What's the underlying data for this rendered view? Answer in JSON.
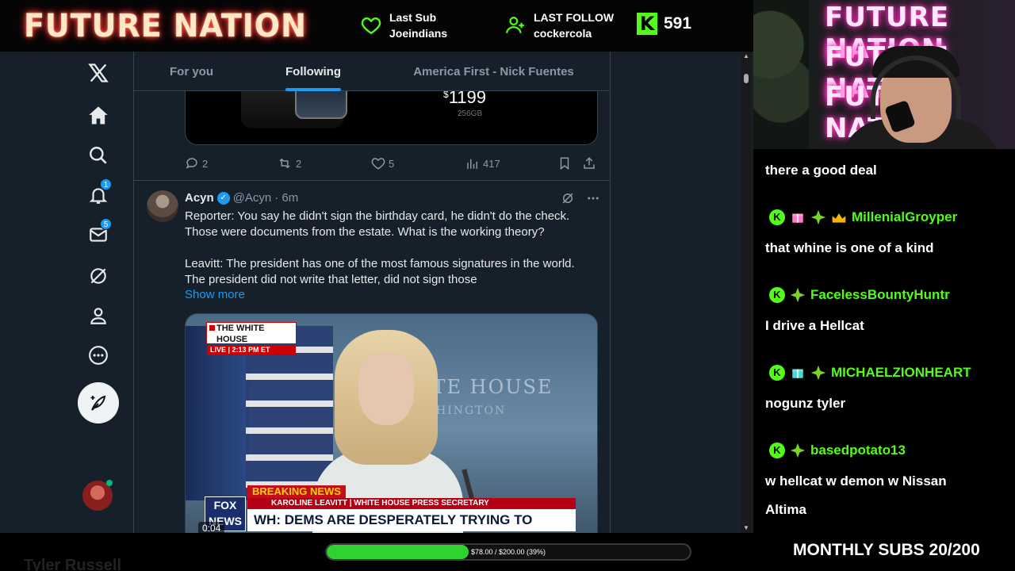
{
  "overlay": {
    "logo": "FUTURE NATION",
    "last_sub": {
      "title": "Last Sub",
      "name": "Joeindians"
    },
    "last_follow": {
      "title": "LAST FOLLOW",
      "name": "cockercola"
    },
    "kick_icon": "K",
    "viewer_count": "591",
    "accent_color": "#53fc18"
  },
  "xnav": {
    "items": [
      {
        "icon": "x-logo-icon"
      },
      {
        "icon": "home-icon"
      },
      {
        "icon": "search-icon"
      },
      {
        "icon": "bell-icon",
        "badge": "1"
      },
      {
        "icon": "mail-icon",
        "badge": "5"
      },
      {
        "icon": "grok-icon"
      },
      {
        "icon": "profile-icon"
      },
      {
        "icon": "more-icon"
      }
    ],
    "compose_icon": "feather-icon"
  },
  "tabs": [
    {
      "label": "For you",
      "active": false
    },
    {
      "label": "Following",
      "active": true
    },
    {
      "label": "America First - Nick Fuentes",
      "active": false
    }
  ],
  "prev_tweet": {
    "price_symbol": "$",
    "price": "1199",
    "storage": "256GB",
    "replies": "2",
    "retweets": "2",
    "likes": "5",
    "views": "417"
  },
  "tweet": {
    "name": "Acyn",
    "handle": "@Acyn",
    "time": "· 6m",
    "paragraph1": "Reporter: You say he didn't sign the birthday card, he didn't do the check. Those were documents from the estate. What is the working theory?",
    "paragraph2": "Leavitt: The president has one of the most famous signatures in the world. The president did not write that letter, did not sign those",
    "show_more": "Show more",
    "video": {
      "bg_text": "ITE HOUSE",
      "bg_sub": "HINGTON",
      "chyron_top": "THE WHITE HOUSE",
      "chyron_live": "LIVE | 2:13 PM ET",
      "network": "FOX NEWS",
      "breaking": "BREAKING NEWS",
      "lower_name": "KAROLINE LEAVITT | WHITE HOUSE PRESS SECRETARY",
      "headline": "WH: DEMS ARE DESPERATELY TRYING TO CONCOCT A HOAX",
      "timestamp": "0:04"
    }
  },
  "webcam": {
    "neon_lines": [
      "FUTURE NATION",
      "FUTURE NATION",
      "FUTURE NATION"
    ]
  },
  "chat": {
    "messages": [
      {
        "user": "",
        "text": "there a good deal"
      },
      {
        "user": "MillenialGroyper",
        "text": "that whine is one of a kind",
        "badges": [
          "kick",
          "gift",
          "sparkle",
          "crown"
        ]
      },
      {
        "user": "FacelessBountyHuntr",
        "text": "I drive a Hellcat",
        "badges": [
          "kick",
          "sparkle"
        ]
      },
      {
        "user": "MICHAELZIONHEART",
        "text": "nogunz tyler",
        "badges": [
          "kick",
          "gift",
          "sparkle"
        ]
      },
      {
        "user": "basedpotato13",
        "text": "w hellcat w demon w Nissan",
        "text2": "Altima",
        "badges": [
          "kick",
          "sparkle"
        ]
      }
    ]
  },
  "bottom": {
    "progress_text": "$78.00 / $200.00 (39%)",
    "progress_fraction": 0.39,
    "monthly": "MONTHLY SUBS 20/200",
    "ghost_name": "Tyler Russell"
  }
}
